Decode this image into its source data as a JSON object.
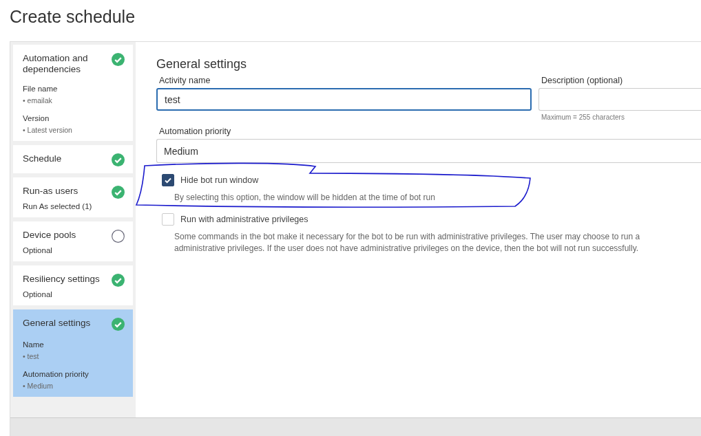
{
  "page_title": "Create schedule",
  "steps": [
    {
      "title": "Automation and dependencies",
      "done": true,
      "selected": false,
      "details": [
        {
          "kind": "label",
          "text": "File name"
        },
        {
          "kind": "value",
          "text": "• emailak"
        },
        {
          "kind": "label",
          "text": "Version"
        },
        {
          "kind": "value",
          "text": "• Latest version"
        }
      ]
    },
    {
      "title": "Schedule",
      "done": true,
      "selected": false
    },
    {
      "title": "Run-as users",
      "done": true,
      "selected": false,
      "details": [
        {
          "kind": "note",
          "text": "Run As selected (1)"
        }
      ]
    },
    {
      "title": "Device pools",
      "done": false,
      "selected": false,
      "details": [
        {
          "kind": "note",
          "text": "Optional"
        }
      ]
    },
    {
      "title": "Resiliency settings",
      "done": true,
      "selected": false,
      "details": [
        {
          "kind": "note",
          "text": "Optional"
        }
      ]
    },
    {
      "title": "General settings",
      "done": true,
      "selected": true,
      "details": [
        {
          "kind": "label",
          "text": "Name"
        },
        {
          "kind": "value",
          "text": "• test"
        },
        {
          "kind": "label",
          "text": "Automation priority"
        },
        {
          "kind": "value",
          "text": "• Medium"
        }
      ]
    }
  ],
  "section_title": "General settings",
  "activity_name": {
    "label": "Activity name",
    "value": "test",
    "focused": true
  },
  "description": {
    "label": "Description (optional)",
    "hint": "Maximum = 255 characters"
  },
  "priority": {
    "label": "Automation priority",
    "value": "Medium"
  },
  "options": [
    {
      "label": "Hide bot run window",
      "checked": true,
      "help": "By selecting this option, the window will be hidden at the time of bot run"
    },
    {
      "label": "Run with administrative privileges",
      "checked": false,
      "help": "Some commands in the bot make it necessary for the bot to be run with administrative privileges. The user may choose to run a\nadministrative privileges. If the user does not have administrative privileges on the device, then the bot will not run successfully."
    }
  ]
}
